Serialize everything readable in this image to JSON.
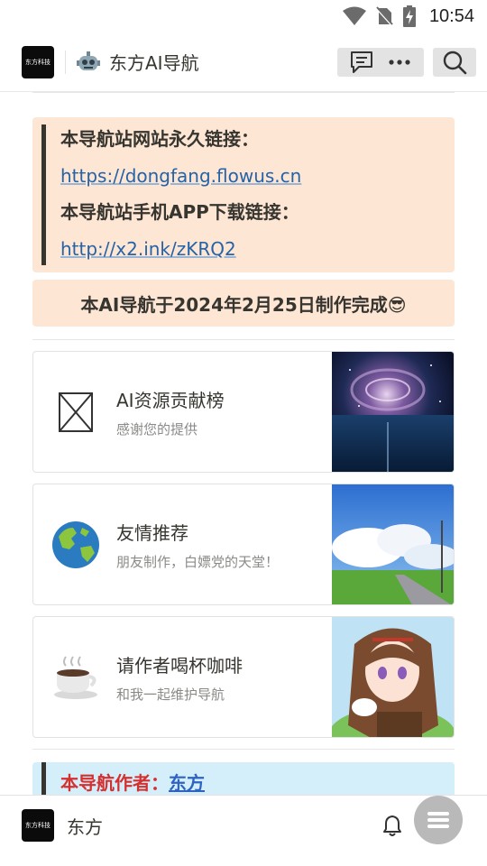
{
  "status_bar": {
    "time": "10:54"
  },
  "header": {
    "logo_text": "东方科技",
    "title": "东方AI导航",
    "comment_icon": "comment-icon",
    "more_icon": "more-icon",
    "search_icon": "search-icon"
  },
  "callout_links": {
    "line1": "本导航站网站永久链接：",
    "link1": "https://dongfang.flowus.cn",
    "line2": "本导航站手机APP下载链接：",
    "link2": "http://x2.ink/zKRQ2"
  },
  "notice": {
    "text": "本AI导航于2024年2月25日制作完成😎"
  },
  "cards": [
    {
      "title": "AI资源贡献榜",
      "subtitle": "感谢您的提供",
      "icon": "broken-image-icon"
    },
    {
      "title": "友情推荐",
      "subtitle": "朋友制作，白嫖党的天堂！",
      "icon": "globe-icon"
    },
    {
      "title": "请作者喝杯咖啡",
      "subtitle": "和我一起维护导航",
      "icon": "coffee-icon"
    }
  ],
  "author": {
    "label": "本导航作者：",
    "name": "东方"
  },
  "bottom_bar": {
    "logo_text": "东方科技",
    "name": "东方",
    "bell_icon": "bell-icon",
    "menu_icon": "menu-icon"
  },
  "colors": {
    "callout_orange": "#fde6d4",
    "callout_blue": "#d4eefa",
    "link": "#2563a8",
    "author_red": "#d4302f"
  }
}
